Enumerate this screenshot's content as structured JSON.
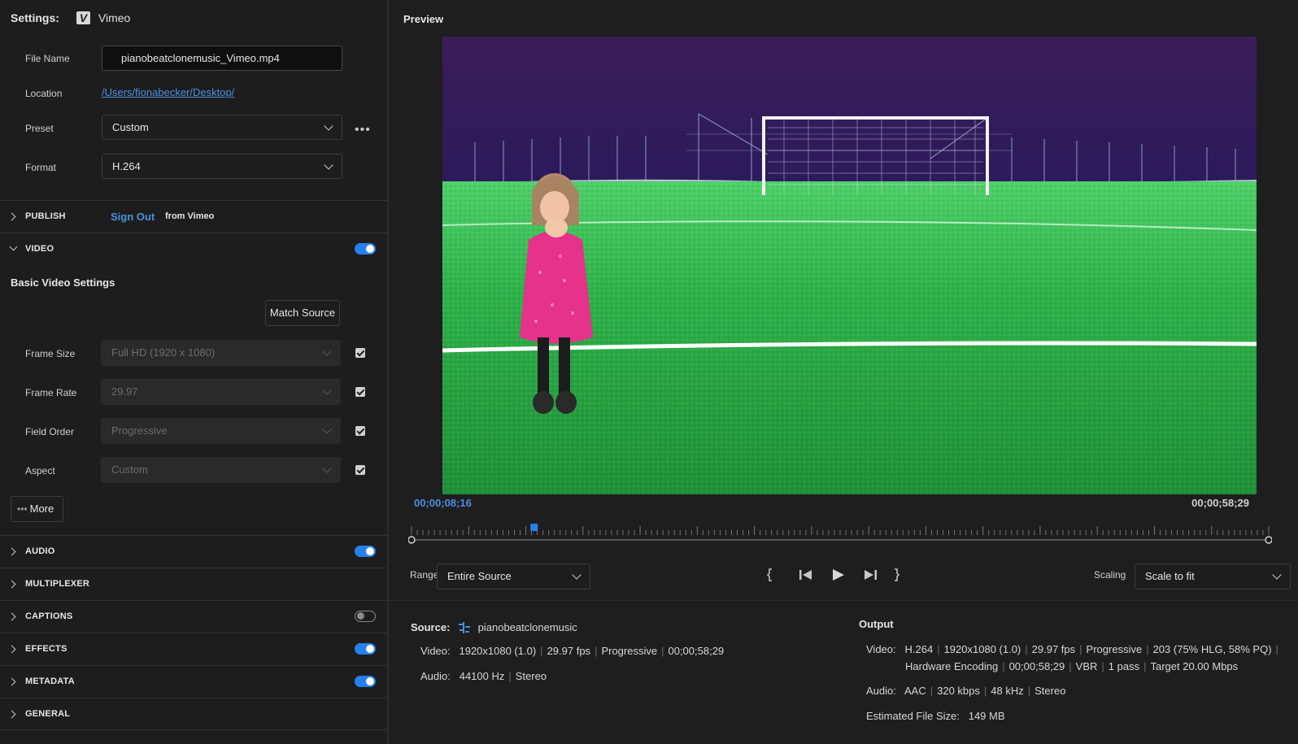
{
  "settings": {
    "label": "Settings:",
    "destination": "Vimeo",
    "file_name_label": "File Name",
    "file_name": "pianobeatclonemusic_Vimeo.mp4",
    "location_label": "Location",
    "location": "/Users/fionabecker/Desktop/",
    "preset_label": "Preset",
    "preset": "Custom",
    "format_label": "Format",
    "format": "H.264"
  },
  "publish": {
    "title": "PUBLISH",
    "sign_out": "Sign Out",
    "from": "from Vimeo"
  },
  "video": {
    "title": "VIDEO",
    "enabled": true,
    "basic_heading": "Basic Video Settings",
    "match_source": "Match Source",
    "frame_size_label": "Frame Size",
    "frame_size": "Full HD (1920 x 1080)",
    "frame_rate_label": "Frame Rate",
    "frame_rate": "29.97",
    "field_order_label": "Field Order",
    "field_order": "Progressive",
    "aspect_label": "Aspect",
    "aspect": "Custom",
    "more": "More"
  },
  "sections": [
    {
      "title": "AUDIO",
      "enabled": true
    },
    {
      "title": "MULTIPLEXER"
    },
    {
      "title": "CAPTIONS",
      "enabled": false
    },
    {
      "title": "EFFECTS",
      "enabled": true
    },
    {
      "title": "METADATA",
      "enabled": true
    },
    {
      "title": "GENERAL"
    }
  ],
  "preview": {
    "title": "Preview",
    "current_time": "00;00;08;16",
    "duration": "00;00;58;29",
    "playhead_fraction": 0.143,
    "range_label": "Range",
    "range": "Entire Source",
    "scaling_label": "Scaling",
    "scaling": "Scale to fit"
  },
  "source": {
    "label": "Source:",
    "name": "pianobeatclonemusic",
    "video_label": "Video:",
    "video": [
      "1920x1080 (1.0)",
      "29.97 fps",
      "Progressive",
      "00;00;58;29"
    ],
    "audio_label": "Audio:",
    "audio": [
      "44100 Hz",
      "Stereo"
    ]
  },
  "output": {
    "label": "Output",
    "video_label": "Video:",
    "video_line1": [
      "H.264",
      "1920x1080 (1.0)",
      "29.97 fps",
      "Progressive",
      "203 (75% HLG, 58% PQ)"
    ],
    "video_line2": [
      "Hardware Encoding",
      "00;00;58;29",
      "VBR",
      "1 pass",
      "Target 20.00 Mbps"
    ],
    "audio_label": "Audio:",
    "audio": [
      "AAC",
      "320 kbps",
      "48 kHz",
      "Stereo"
    ],
    "size_label": "Estimated File Size:",
    "size": "149 MB"
  },
  "colors": {
    "accent": "#2680eb",
    "link": "#4a90e2",
    "panel": "#1d1d1d"
  },
  "icons": [
    "chevron-down-icon",
    "more-icon",
    "play-icon",
    "step-back-icon",
    "step-forward-icon",
    "mark-in-icon",
    "mark-out-icon",
    "vimeo-icon",
    "sequence-icon"
  ]
}
